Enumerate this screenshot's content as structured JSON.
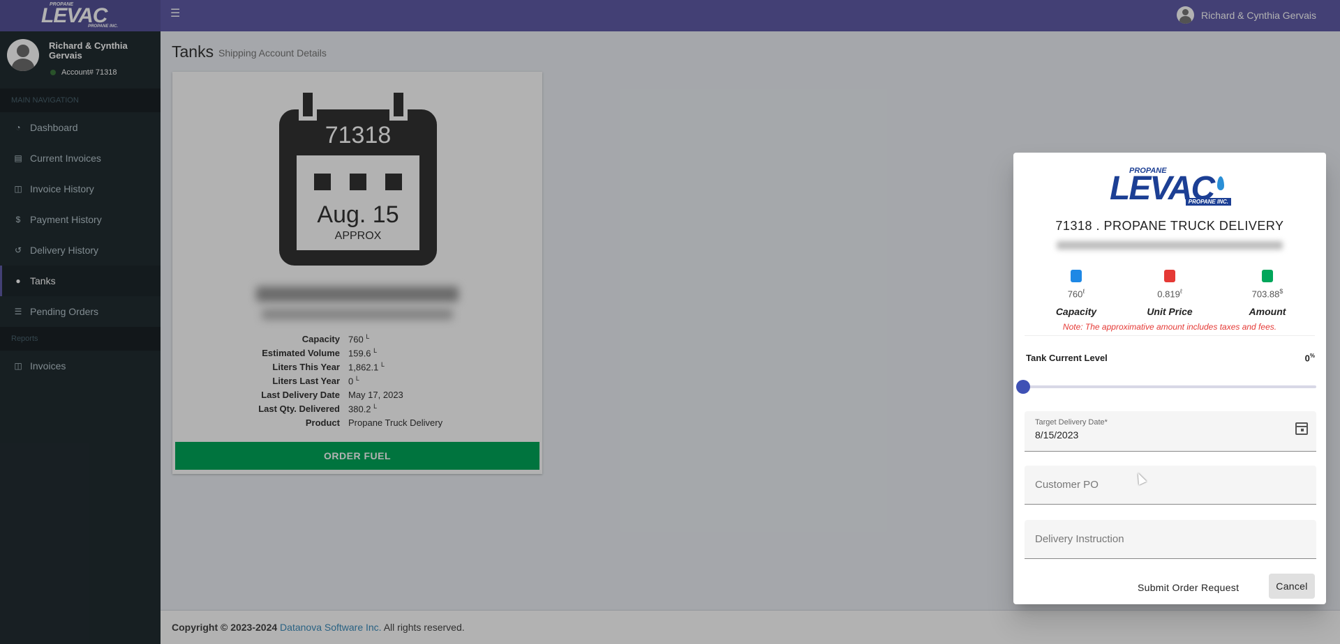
{
  "brand": {
    "logo_top": "PROPANE",
    "logo_main": "LEVAC",
    "logo_bottom": "PROPANE INC."
  },
  "topbar": {
    "menu_icon": "hamburger-icon",
    "user_name": "Richard & Cynthia Gervais"
  },
  "sidebar": {
    "user_name": "Richard & Cynthia Gervais",
    "account": "Account# 71318",
    "section_main": "MAIN NAVIGATION",
    "items": [
      {
        "label": "Dashboard",
        "icon": "dashboard-icon"
      },
      {
        "label": "Current Invoices",
        "icon": "credit-card-icon"
      },
      {
        "label": "Invoice History",
        "icon": "pdf-file-icon"
      },
      {
        "label": "Payment History",
        "icon": "dollar-icon"
      },
      {
        "label": "Delivery History",
        "icon": "history-icon"
      },
      {
        "label": "Tanks",
        "icon": "drop-icon"
      },
      {
        "label": "Pending Orders",
        "icon": "list-icon"
      }
    ],
    "section_reports": "Reports",
    "report_items": [
      {
        "label": "Invoices",
        "icon": "file-icon"
      }
    ]
  },
  "page": {
    "title": "Tanks",
    "subtitle": "Shipping Account Details"
  },
  "tank": {
    "account_number": "71318",
    "date": "Aug. 15",
    "approx": "APPROX",
    "specs": [
      {
        "label": "Capacity",
        "value": "760",
        "unit": "L"
      },
      {
        "label": "Estimated Volume",
        "value": "159.6",
        "unit": "L"
      },
      {
        "label": "Liters This Year",
        "value": "1,862.1",
        "unit": "L"
      },
      {
        "label": "Liters Last Year",
        "value": "0",
        "unit": "L"
      },
      {
        "label": "Last Delivery Date",
        "value": "May 17, 2023",
        "unit": ""
      },
      {
        "label": "Last Qty. Delivered",
        "value": "380.2",
        "unit": "L"
      },
      {
        "label": "Product",
        "value": "Propane Truck Delivery",
        "unit": ""
      }
    ],
    "order_button": "ORDER FUEL"
  },
  "footer": {
    "prefix": "Copyright © 2023-2024",
    "company": "Datanova Software Inc.",
    "suffix": "All rights reserved."
  },
  "modal": {
    "title": "71318 . PROPANE TRUCK DELIVERY",
    "stats": [
      {
        "value": "760",
        "unit": "ℓ",
        "label": "Capacity",
        "icon": "tank-icon",
        "color": "#1e88e5"
      },
      {
        "value": "0.819",
        "unit": "ℓ",
        "label": "Unit Price",
        "icon": "gas-pump-icon",
        "color": "#e53935"
      },
      {
        "value": "703.88",
        "unit": "$",
        "label": "Amount",
        "icon": "money-icon",
        "color": "#00a65a"
      }
    ],
    "note": "Note: The approximative amount includes taxes and fees.",
    "tank_level_label": "Tank Current Level",
    "tank_level_value": "0",
    "tank_level_unit": "%",
    "tank_level_fraction": 0,
    "delivery_date_label": "Target Delivery Date*",
    "delivery_date_value": "8/15/2023",
    "customer_po_placeholder": "Customer PO",
    "delivery_instruction_placeholder": "Delivery Instruction",
    "submit_label": "Submit Order Request",
    "cancel_label": "Cancel"
  },
  "colors": {
    "topbar": "#605ca8",
    "sidebar": "#222d32",
    "order_button": "#00a65a",
    "slider": "#3f51b5",
    "note": "#e53935"
  }
}
